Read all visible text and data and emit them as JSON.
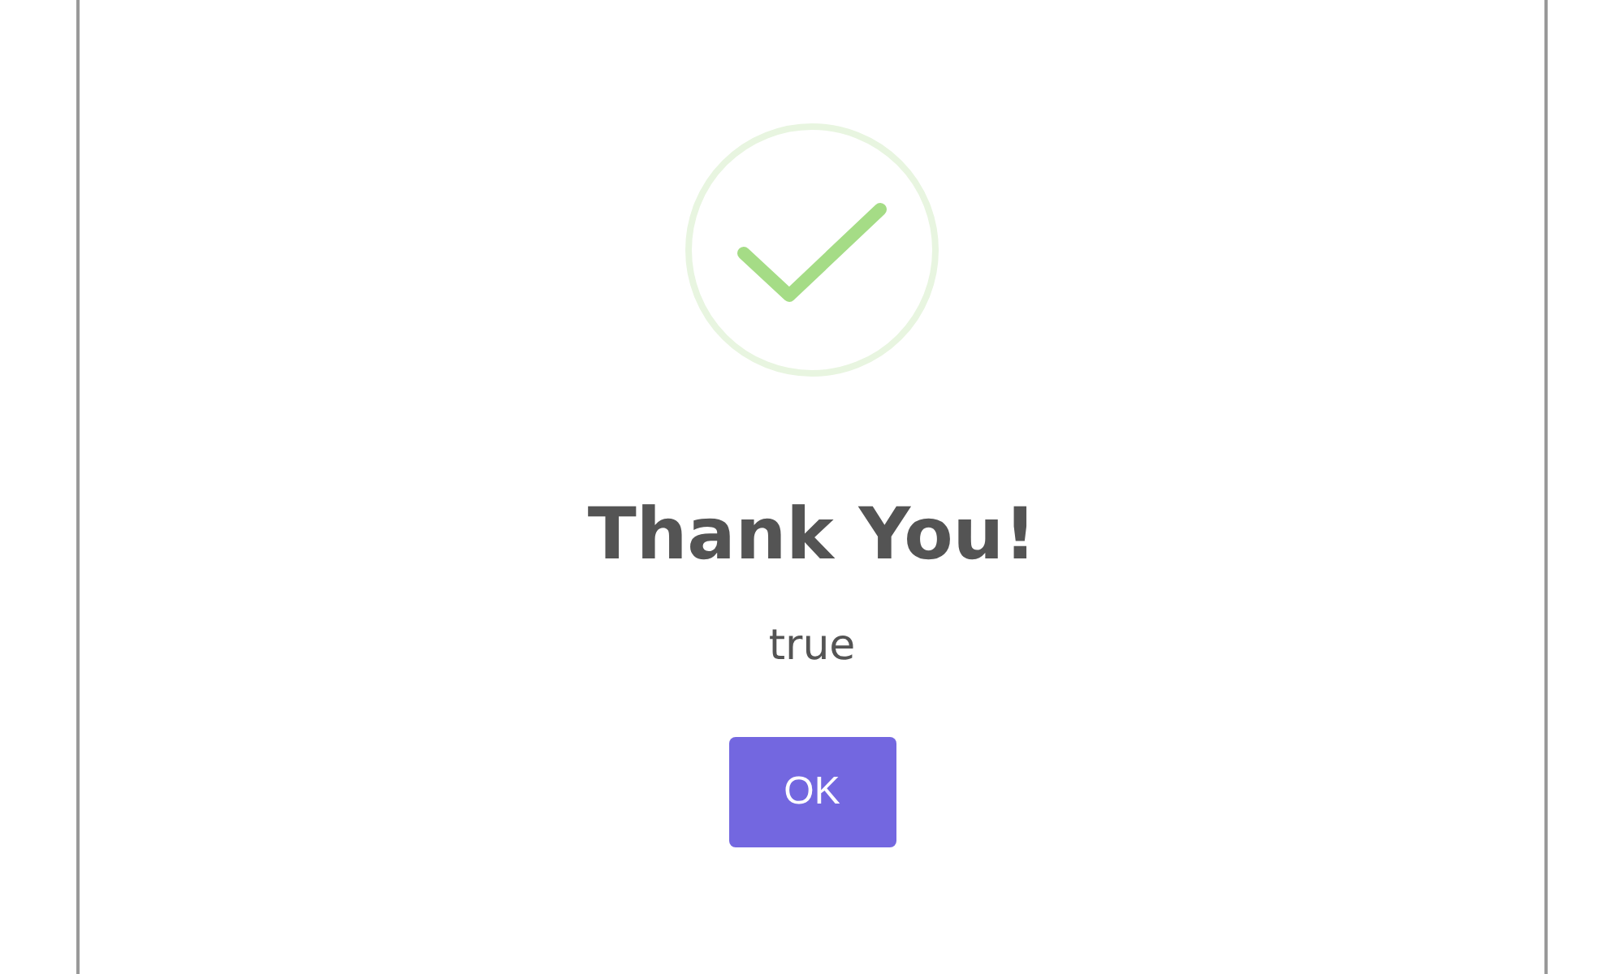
{
  "dialog": {
    "icon": {
      "kind": "success"
    },
    "title": "Thank You!",
    "message": "true",
    "buttons": [
      {
        "label": "OK"
      }
    ]
  }
}
